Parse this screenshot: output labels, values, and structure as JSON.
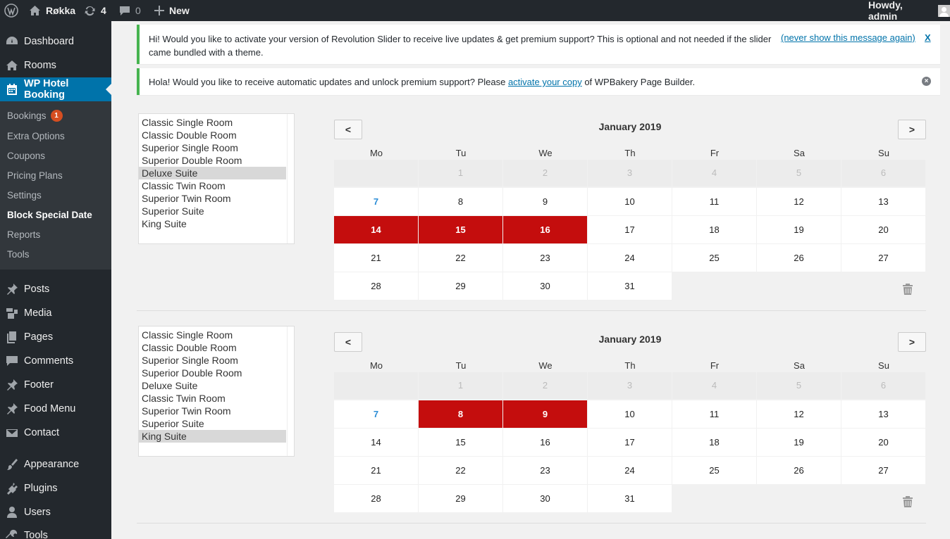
{
  "adminbar": {
    "site_name": "Røkka",
    "updates_count": "4",
    "comments_count": "0",
    "new_label": "New",
    "greeting": "Howdy, admin"
  },
  "sidebar": {
    "top": [
      {
        "label": "Dashboard"
      },
      {
        "label": "Rooms"
      },
      {
        "label": "WP Hotel Booking"
      }
    ],
    "submenu": [
      {
        "label": "Bookings",
        "badge": "1"
      },
      {
        "label": "Extra Options"
      },
      {
        "label": "Coupons"
      },
      {
        "label": "Pricing Plans"
      },
      {
        "label": "Settings"
      },
      {
        "label": "Block Special Date"
      },
      {
        "label": "Reports"
      },
      {
        "label": "Tools"
      }
    ],
    "bottom": [
      {
        "label": "Posts"
      },
      {
        "label": "Media"
      },
      {
        "label": "Pages"
      },
      {
        "label": "Comments"
      },
      {
        "label": "Footer"
      },
      {
        "label": "Food Menu"
      },
      {
        "label": "Contact"
      },
      {
        "label": "Appearance"
      },
      {
        "label": "Plugins"
      },
      {
        "label": "Users"
      },
      {
        "label": "Tools"
      }
    ]
  },
  "notices": [
    {
      "text_before": "Hi! Would you like to activate your version of Revolution Slider to receive live updates & get premium support? This is optional and not needed if the slider came bundled with a theme.",
      "link": "(never show this message again)",
      "close": "X"
    },
    {
      "text_before": "Hola! Would you like to receive automatic updates and unlock premium support? Please ",
      "link": "activate your copy",
      "text_after": " of WPBakery Page Builder."
    }
  ],
  "rooms": [
    "Classic Single Room",
    "Classic Double Room",
    "Superior Single Room",
    "Superior Double Room",
    "Deluxe Suite",
    "Classic Twin Room",
    "Superior Twin Room",
    "Superior Suite",
    "King Suite"
  ],
  "calendar": {
    "prev": "<",
    "next": ">",
    "weekdays": [
      "Mo",
      "Tu",
      "We",
      "Th",
      "Fr",
      "Sa",
      "Su"
    ],
    "leading_days": [
      "1",
      "2",
      "3",
      "4",
      "5",
      "6"
    ],
    "weeks": [
      [
        "7",
        "8",
        "9",
        "10",
        "11",
        "12",
        "13"
      ],
      [
        "14",
        "15",
        "16",
        "17",
        "18",
        "19",
        "20"
      ],
      [
        "21",
        "22",
        "23",
        "24",
        "25",
        "26",
        "27"
      ],
      [
        "28",
        "29",
        "30",
        "31"
      ]
    ]
  },
  "blocks": [
    {
      "month": "January 2019",
      "selected_room": "Deluxe Suite",
      "blocked_days": [
        "14",
        "15",
        "16"
      ]
    },
    {
      "month": "January 2019",
      "selected_room": "King Suite",
      "blocked_days": [
        "8",
        "9"
      ]
    }
  ],
  "colors": {
    "accent": "#0073aa",
    "blocked": "#c40d0d",
    "today": "#2c8dd6",
    "notice_border": "#46b450"
  }
}
